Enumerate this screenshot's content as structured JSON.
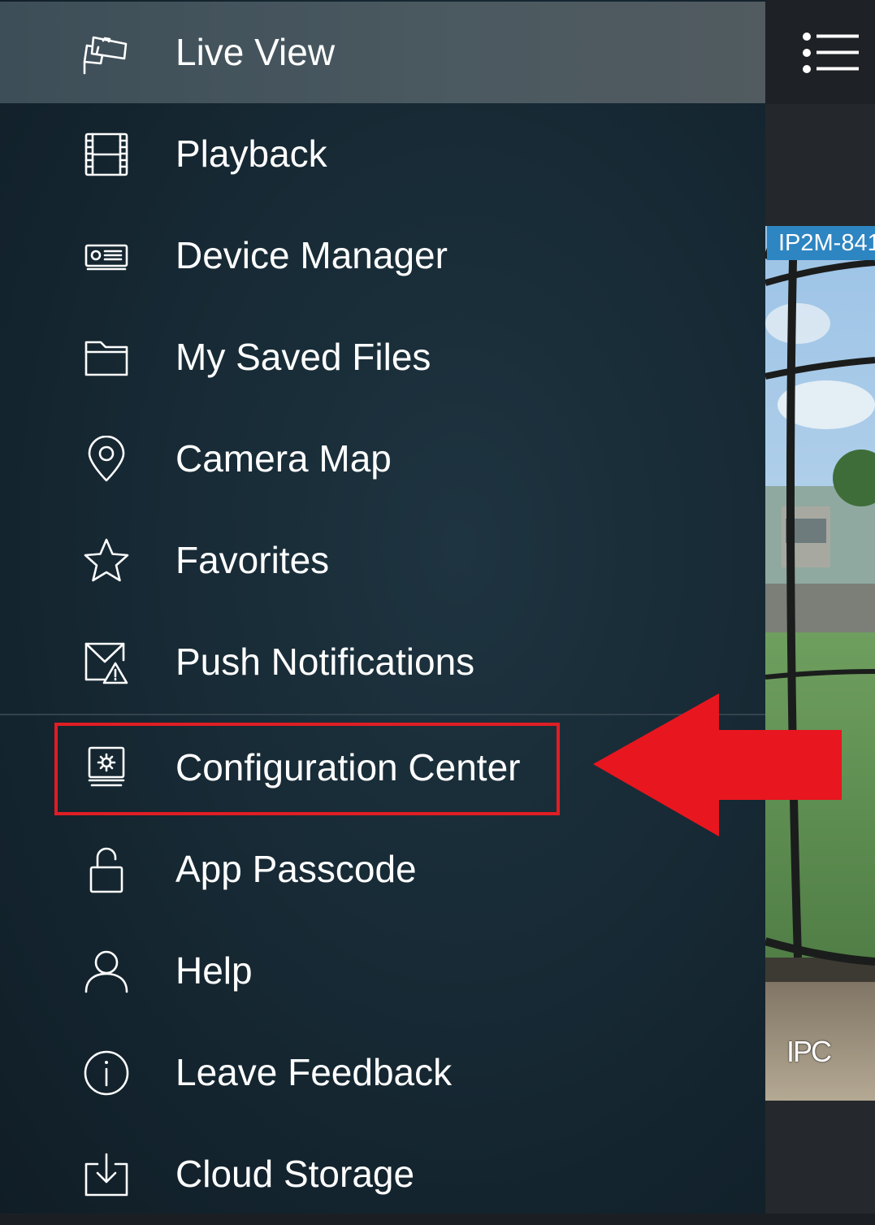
{
  "drawer": {
    "items": [
      {
        "label": "Live View",
        "icon": "security-camera-icon",
        "active": true
      },
      {
        "label": "Playback",
        "icon": "film-strip-icon"
      },
      {
        "label": "Device Manager",
        "icon": "dvr-device-icon"
      },
      {
        "label": "My Saved Files",
        "icon": "folder-icon"
      },
      {
        "label": "Camera Map",
        "icon": "map-pin-icon"
      },
      {
        "label": "Favorites",
        "icon": "star-icon"
      },
      {
        "label": "Push Notifications",
        "icon": "mail-alert-icon"
      },
      {
        "label": "Configuration Center",
        "icon": "monitor-gear-icon"
      },
      {
        "label": "App Passcode",
        "icon": "unlocked-padlock-icon"
      },
      {
        "label": "Help",
        "icon": "person-icon"
      },
      {
        "label": "Leave Feedback",
        "icon": "info-circle-icon"
      },
      {
        "label": "Cloud Storage",
        "icon": "download-tray-icon"
      }
    ]
  },
  "liveview": {
    "channel_label": "IP2M-841",
    "channel_type": "IPC",
    "menu_icon": "list-menu-icon"
  },
  "annotation": {
    "highlight_color": "#e01d24",
    "highlighted_item": "Configuration Center"
  }
}
